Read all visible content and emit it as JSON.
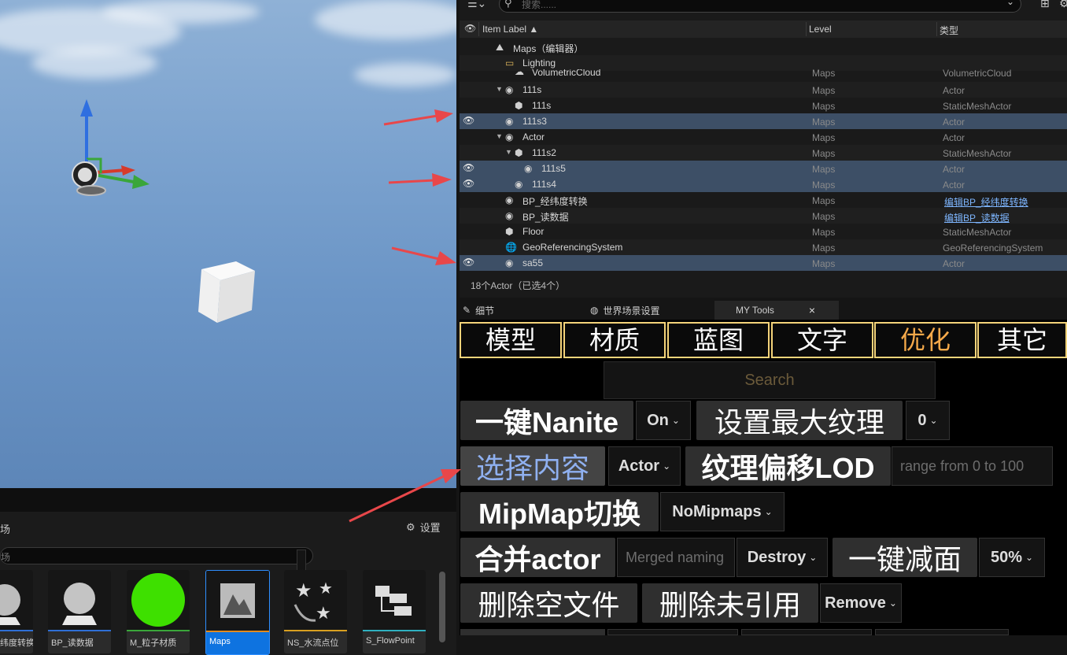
{
  "outliner": {
    "search_placeholder": "搜索......",
    "columns": {
      "label": "Item Label ▲",
      "level": "Level",
      "type": "类型"
    },
    "rows": [
      {
        "name": "Maps（编辑器）",
        "level": "",
        "type": "",
        "icon": "map-icon"
      },
      {
        "name": "Lighting",
        "level": "",
        "type": "",
        "icon": "folder-icon"
      },
      {
        "name": "VolumetricCloud",
        "level": "Maps",
        "type": "VolumetricCloud",
        "icon": "cloud-icon"
      },
      {
        "name": "111s",
        "level": "Maps",
        "type": "Actor",
        "icon": "actor-icon"
      },
      {
        "name": "111s",
        "level": "Maps",
        "type": "StaticMeshActor",
        "icon": "cube-icon"
      },
      {
        "name": "111s3",
        "level": "Maps",
        "type": "Actor",
        "icon": "actor-icon"
      },
      {
        "name": "Actor",
        "level": "Maps",
        "type": "Actor",
        "icon": "actor-icon"
      },
      {
        "name": "111s2",
        "level": "Maps",
        "type": "StaticMeshActor",
        "icon": "cube-icon"
      },
      {
        "name": "111s5",
        "level": "Maps",
        "type": "Actor",
        "icon": "actor-icon"
      },
      {
        "name": "111s4",
        "level": "Maps",
        "type": "Actor",
        "icon": "actor-icon"
      },
      {
        "name": "BP_经纬度转换",
        "level": "Maps",
        "type": "编辑BP_经纬度转换",
        "icon": "actor-icon"
      },
      {
        "name": "BP_读数据",
        "level": "Maps",
        "type": "编辑BP_读数据",
        "icon": "actor-icon"
      },
      {
        "name": "Floor",
        "level": "Maps",
        "type": "StaticMeshActor",
        "icon": "cube-icon"
      },
      {
        "name": "GeoReferencingSystem",
        "level": "Maps",
        "type": "GeoReferencingSystem",
        "icon": "globe-icon"
      },
      {
        "name": "sa55",
        "level": "Maps",
        "type": "Actor",
        "icon": "actor-icon"
      }
    ],
    "status": "18个Actor（已选4个）"
  },
  "tabs": {
    "details": "细节",
    "world_settings": "世界场景设置",
    "my_tools": "MY Tools",
    "close": "×"
  },
  "tools": {
    "categories": [
      "模型",
      "材质",
      "蓝图",
      "文字",
      "优化",
      "其它"
    ],
    "search_placeholder": "Search",
    "nanite_button": "一键Nanite",
    "nanite_option": "On",
    "max_texture_button": "设置最大纹理",
    "max_texture_option": "0",
    "select_content_button": "选择内容",
    "select_content_option": "Actor",
    "texture_lod_button": "纹理偏移LOD",
    "lod_range_placeholder": "range from 0 to 100",
    "mipmap_button": "MipMap切换",
    "mipmap_option": "NoMipmaps",
    "merge_button": "合并actor",
    "merge_placeholder": "Merged naming",
    "merge_option": "Destroy",
    "reduce_button": "一键减面",
    "reduce_option": "50%",
    "delete_empty_button": "删除空文件",
    "delete_unref_button": "删除未引用",
    "delete_option": "Remove"
  },
  "content_browser": {
    "title": "场",
    "settings": "设置",
    "search_placeholder": "场",
    "assets": [
      {
        "label": "纬度转换",
        "bar_color": "#2f6fd6"
      },
      {
        "label": "BP_读数据",
        "bar_color": "#2f6fd6"
      },
      {
        "label": "M_粒子材质",
        "bar_color": "#3aa63a"
      },
      {
        "label": "Maps",
        "bar_color": "#e08a1e"
      },
      {
        "label": "NS_水流点位",
        "bar_color": "#d9a020"
      },
      {
        "label": "S_FlowPoint",
        "bar_color": "#2fb0c0"
      }
    ]
  },
  "colors": {
    "category_border": "#f5d47a",
    "category_highlight": "#f5a94a",
    "selected_row": "#3d4f66",
    "arrow": "#e8474a"
  }
}
